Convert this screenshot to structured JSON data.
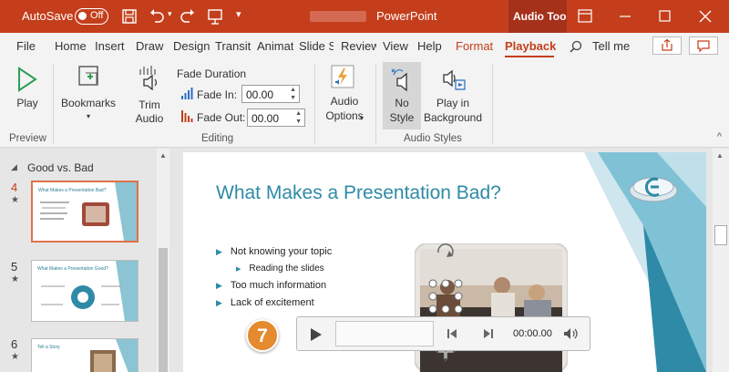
{
  "titlebar": {
    "autosave_label": "AutoSave",
    "autosave_state": "Off",
    "app_title": "PowerPoint",
    "context_tab": "Audio Tools"
  },
  "tabs": [
    {
      "label": "File"
    },
    {
      "label": "Home"
    },
    {
      "label": "Insert"
    },
    {
      "label": "Draw"
    },
    {
      "label": "Design"
    },
    {
      "label": "Transitions"
    },
    {
      "label": "Animations"
    },
    {
      "label": "Slide Show"
    },
    {
      "label": "Review"
    },
    {
      "label": "View"
    },
    {
      "label": "Help"
    },
    {
      "label": "Format"
    },
    {
      "label": "Playback"
    }
  ],
  "tell_me": "Tell me",
  "ribbon": {
    "play": "Play",
    "bookmarks": "Bookmarks",
    "trim_audio_1": "Trim",
    "trim_audio_2": "Audio",
    "fade_duration": "Fade Duration",
    "fade_in_label": "Fade In:",
    "fade_in_value": "00.00",
    "fade_out_label": "Fade Out:",
    "fade_out_value": "00.00",
    "audio_options_1": "Audio",
    "audio_options_2": "Options",
    "no_style_1": "No",
    "no_style_2": "Style",
    "play_bg_1": "Play in",
    "play_bg_2": "Background",
    "groups": {
      "preview": "Preview",
      "editing": "Editing",
      "audio_styles": "Audio Styles"
    }
  },
  "thumbnails": {
    "section_title": "Good vs. Bad",
    "slides": [
      {
        "number": "4",
        "title": "What Makes a Presentation Bad?"
      },
      {
        "number": "5",
        "title": "What Makes a Presentation Good?"
      },
      {
        "number": "6",
        "title": "Tell a Story"
      }
    ]
  },
  "slide": {
    "title": "What Makes a Presentation Bad?",
    "bullets": [
      {
        "text": "Not knowing your topic",
        "level": 1
      },
      {
        "text": "Reading the slides",
        "level": 2
      },
      {
        "text": "Too much information",
        "level": 1
      },
      {
        "text": "Lack of excitement",
        "level": 1
      }
    ]
  },
  "player": {
    "time": "00:00.00"
  },
  "callout": "7",
  "colors": {
    "accent": "#c43e1c",
    "slide_title": "#2e8aa6",
    "callout": "#e58a2e"
  }
}
